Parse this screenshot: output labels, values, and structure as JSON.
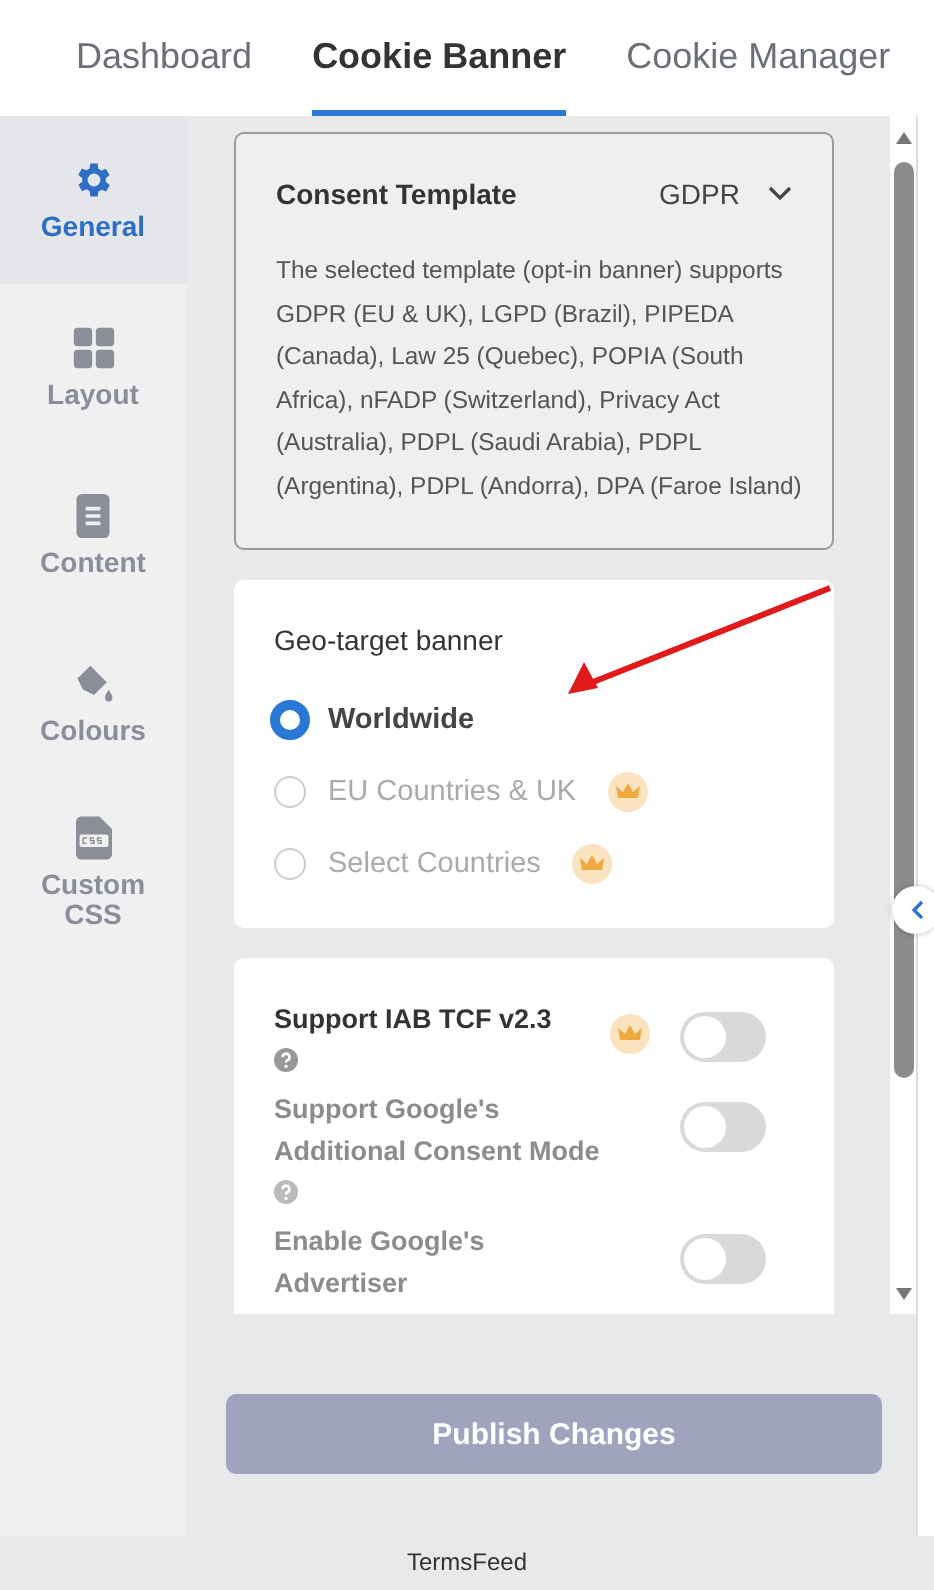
{
  "tabs": [
    {
      "label": "Dashboard",
      "selected": false
    },
    {
      "label": "Cookie Banner",
      "selected": true
    },
    {
      "label": "Cookie Manager",
      "selected": false
    }
  ],
  "sidebar": {
    "items": [
      {
        "label": "General",
        "kind": "gear",
        "selected": true
      },
      {
        "label": "Layout",
        "kind": "grid",
        "selected": false
      },
      {
        "label": "Content",
        "kind": "document",
        "selected": false
      },
      {
        "label": "Colours",
        "kind": "bucket",
        "selected": false
      },
      {
        "label": "Custom CSS",
        "kind": "css",
        "selected": false
      }
    ]
  },
  "consent_template": {
    "title": "Consent Template",
    "value": "GDPR",
    "description": "The selected template (opt-in banner) supports GDPR (EU & UK), LGPD (Brazil), PIPEDA (Canada), Law 25 (Quebec), POPIA (South Africa), nFADP (Switzerland), Privacy Act (Australia), PDPL (Saudi Arabia), PDPL (Argentina), PDPL (Andorra), DPA (Faroe Island)"
  },
  "geo_target": {
    "title": "Geo-target banner",
    "options": [
      {
        "label": "Worldwide",
        "selected": true,
        "disabled": false,
        "premium": false
      },
      {
        "label": "EU Countries & UK",
        "selected": false,
        "disabled": true,
        "premium": true
      },
      {
        "label": "Select Countries",
        "selected": false,
        "disabled": true,
        "premium": true
      }
    ]
  },
  "settings": [
    {
      "label": "Support IAB TCF v2.3",
      "help": true,
      "premium": true,
      "disabled": false,
      "on": false
    },
    {
      "label": "Support Google's Additional Consent Mode",
      "help": true,
      "premium": false,
      "disabled": true,
      "on": false
    },
    {
      "label": "Enable Google's Advertiser",
      "help": false,
      "premium": false,
      "disabled": true,
      "on": false
    }
  ],
  "publish_button": "Publish Changes",
  "footer": "TermsFeed"
}
